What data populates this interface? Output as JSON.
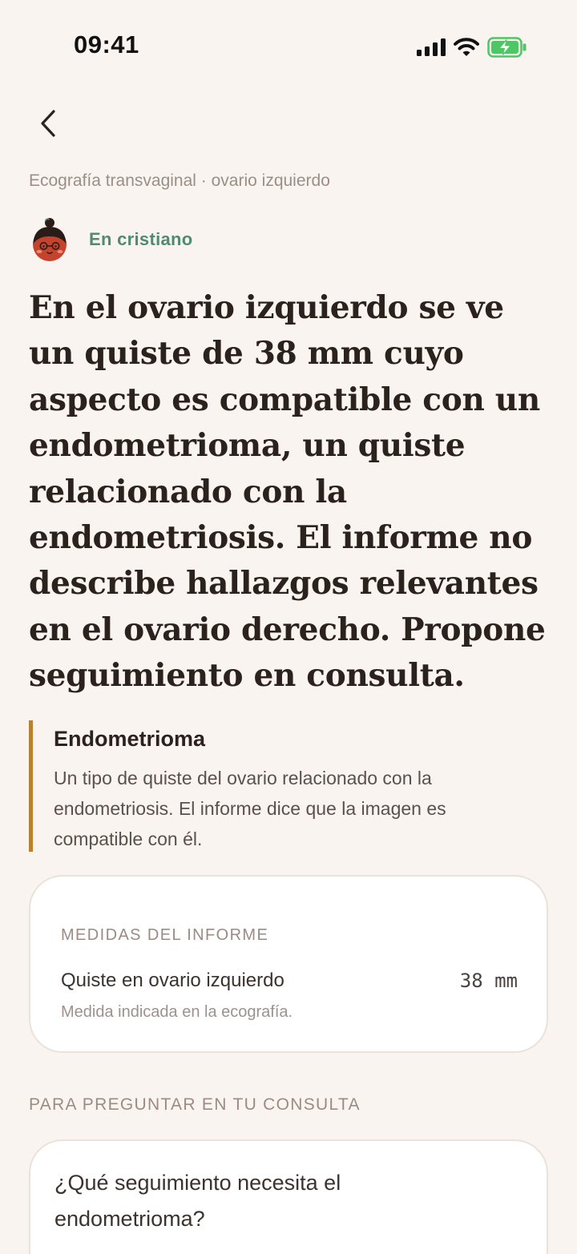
{
  "status_bar": {
    "time": "09:41",
    "icons": [
      "signal-icon",
      "wifi-icon",
      "battery-charging-icon"
    ],
    "battery_color": "#4cc764"
  },
  "navigation": {
    "back_icon": "chevron-left-icon"
  },
  "breadcrumb": "Ecografía transvaginal · ovario izquierdo",
  "persona": {
    "avatar_icon": "doctor-avatar-icon",
    "label": "En cristiano",
    "accent_color": "#4f8a71"
  },
  "summary": {
    "headline": "En el ovario izquierdo se ve un quiste de 38 mm cuyo aspecto es compatible con un endometrioma, un quiste relacionado con la endometriosis. El informe no describe hallazgos relevantes en el ovario derecho. Propone seguimiento en consulta."
  },
  "definition": {
    "term": "Endometrioma",
    "text": "Un tipo de quiste del ovario relacionado con la endometriosis. El informe dice que la imagen es compatible con él.",
    "accent_color": "#b8802f"
  },
  "measurements": {
    "title": "MEDIDAS DEL INFORME",
    "items": [
      {
        "name": "Quiste en ovario izquierdo",
        "value": "38 mm",
        "note": "Medida indicada en la ecografía."
      }
    ]
  },
  "questions": {
    "title": "PARA PREGUNTAR EN TU CONSULTA",
    "items": [
      {
        "text": "¿Qué seguimiento necesita el endometrioma?"
      }
    ]
  }
}
